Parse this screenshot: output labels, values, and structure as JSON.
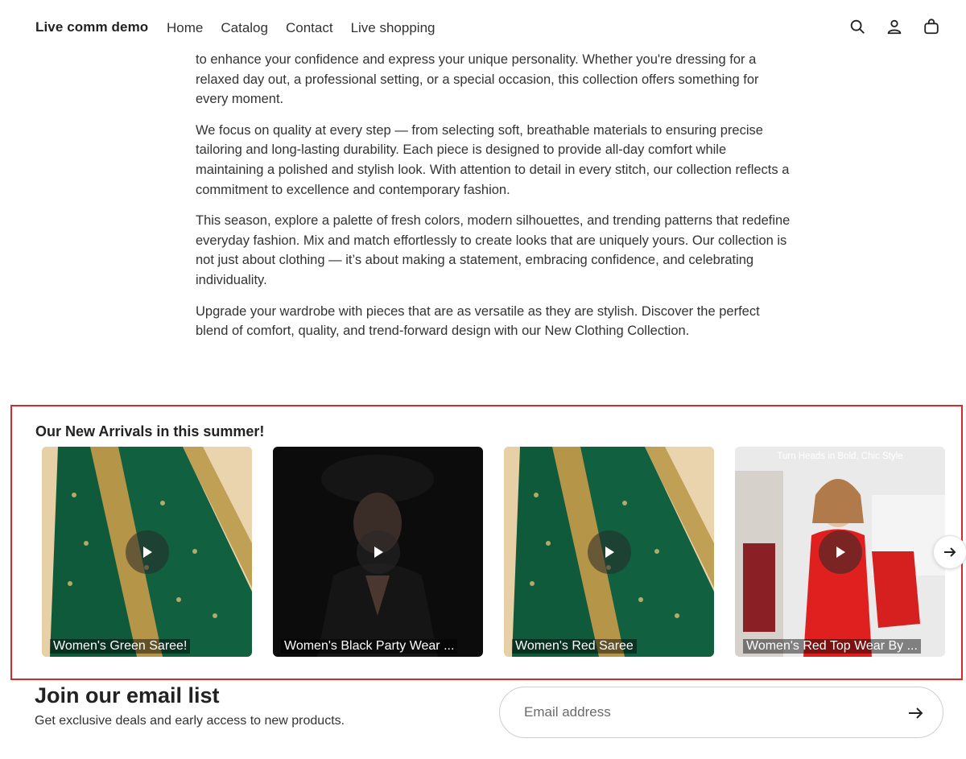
{
  "header": {
    "brand": "Live comm demo",
    "nav": [
      "Home",
      "Catalog",
      "Contact",
      "Live shopping"
    ],
    "icons": [
      "search-icon",
      "account-icon",
      "cart-icon"
    ]
  },
  "content": {
    "paragraphs": [
      "to enhance your confidence and express your unique personality. Whether you're dressing for a relaxed day out, a professional setting, or a special occasion, this collection offers something for every moment.",
      "We focus on quality at every step — from selecting soft, breathable materials to ensuring precise tailoring and long-lasting durability. Each piece is designed to provide all-day comfort while maintaining a polished and stylish look. With attention to detail in every stitch, our collection reflects a commitment to excellence and contemporary fashion.",
      "This season, explore a palette of fresh colors, modern silhouettes, and trending patterns that redefine everyday fashion. Mix and match effortlessly to create looks that are uniquely yours. Our collection is not just about clothing — it’s about making a statement, embracing confidence, and celebrating individuality.",
      "Upgrade your wardrobe with pieces that are as versatile as they are stylish. Discover the perfect blend of comfort, quality, and trend-forward design with our New Clothing Collection."
    ]
  },
  "arrivals": {
    "title": "Our New Arrivals in this summer!",
    "cards": [
      {
        "caption": "Women's Green Saree!",
        "overlay": ""
      },
      {
        "caption": "Women's Black Party Wear ...",
        "overlay": ""
      },
      {
        "caption": "Women's Red Saree",
        "overlay": ""
      },
      {
        "caption": "Women's Red Top Wear By ...",
        "overlay": "Turn Heads in Bold, Chic Style"
      }
    ]
  },
  "newsletter": {
    "title": "Join our email list",
    "subtitle": "Get exclusive deals and early access to new products.",
    "placeholder": "Email address"
  },
  "colors": {
    "highlight": "#d32a2a",
    "saree_green": "#0f5a3a",
    "gold": "#c8a75a",
    "red": "#e0201f"
  }
}
